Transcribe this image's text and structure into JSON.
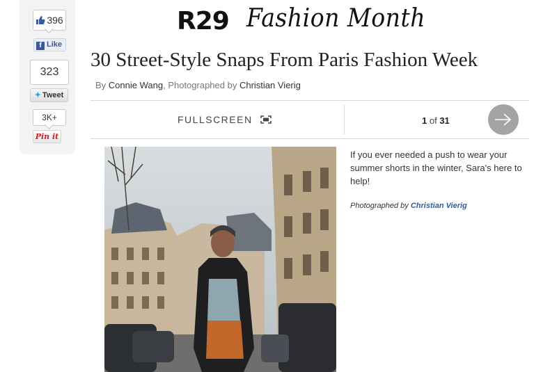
{
  "share": {
    "facebook_count": "396",
    "facebook_label": "Like",
    "tweet_count": "323",
    "tweet_label": "Tweet",
    "pin_count": "3K+",
    "pin_label": "Pin it",
    "facebook_color": "#3b5998",
    "twitter_color": "#2ea3e0",
    "pinterest_color": "#c8232c"
  },
  "header": {
    "logo_mark": "R29",
    "logo_script": "Fashion Month"
  },
  "article": {
    "title": "30 Street-Style Snaps From Paris Fashion Week",
    "by": "By",
    "author": "Connie Wang",
    "photographed_by": ", Photographed by",
    "photographer": "Christian Vierig"
  },
  "slideshow": {
    "fullscreen_label": "FULLSCREEN",
    "current": "1",
    "of": "of",
    "total": "31",
    "next_icon": "arrow-right-icon",
    "caption": "If you ever needed a push to wear your summer shorts in the winter, Sara's here to help!",
    "credit_prefix": "Photographed by",
    "credit_name": "Christian Vierig"
  }
}
